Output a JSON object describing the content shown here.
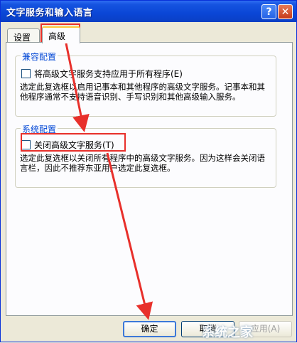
{
  "window": {
    "title": "文字服务和输入语言"
  },
  "titlebar": {
    "help_glyph": "?",
    "close_glyph": "✕"
  },
  "tabs": [
    {
      "label": "设置"
    },
    {
      "label": "高级"
    }
  ],
  "compat_group": {
    "legend": "兼容配置",
    "checkbox_label": "将高级文字服务支持应用于所有程序(E)",
    "checked": false,
    "description": "选定此复选框以启用记事本和其他程序的高级文字服务。记事本和其他程序通常不支持语音识别、手写识别和其他高级输入服务。"
  },
  "system_group": {
    "legend": "系统配置",
    "checkbox_label": "关闭高级文字服务(T)",
    "checked": false,
    "description": "选定此复选框以关闭所有程序中的高级文字服务。因为这样会关闭语言栏，因此不推荐东亚用户选定此复选框。"
  },
  "buttons": {
    "ok": "确定",
    "cancel": "取消",
    "apply": "应用(A)"
  },
  "watermark": "系统之家",
  "colors": {
    "titlebar": "#0a46d6",
    "annotation": "#e8302b",
    "legend": "#0046d5"
  },
  "icons": [
    "help-icon",
    "close-icon",
    "checkbox-icon",
    "annotation-arrow-icon"
  ]
}
